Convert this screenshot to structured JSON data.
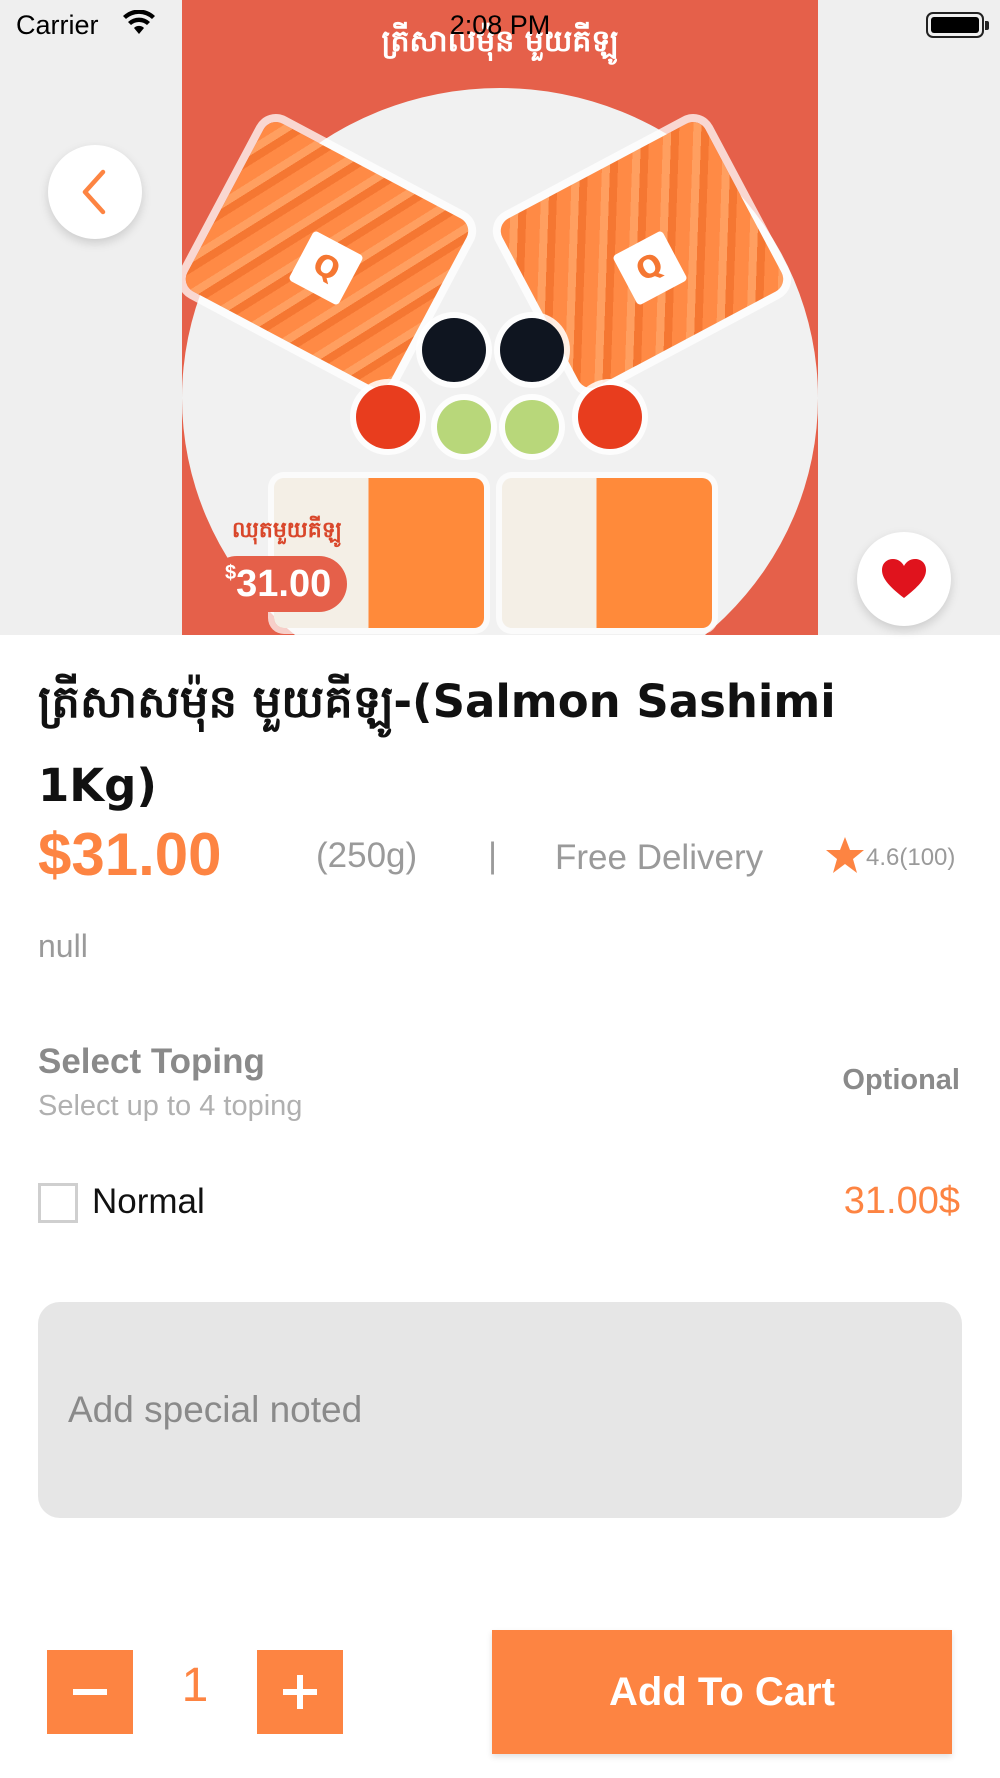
{
  "status_bar": {
    "carrier": "Carrier",
    "time": "2:08 PM",
    "wifi_icon": "wifi-icon",
    "battery_icon": "battery-icon"
  },
  "hero": {
    "banner_text": "ត្រីសាលម៉ុន មួយគីឡូ",
    "promo_caption": "ឈុតមួយគីឡូ",
    "promo_currency": "$",
    "promo_price": "31.00",
    "back_icon": "chevron-left-icon",
    "favorite_icon": "heart-icon"
  },
  "product": {
    "title": "ត្រីសាសម៉ុន មួយគីឡូ-(Salmon Sashimi 1Kg)",
    "price": "$31.00",
    "weight": "(250g)",
    "separator": "|",
    "delivery": "Free Delivery",
    "rating": "4.6(100)",
    "description": "null"
  },
  "topping": {
    "title": "Select Toping",
    "subtitle": "Select up to 4 toping",
    "requirement": "Optional",
    "options": [
      {
        "label": "Normal",
        "price": "31.00$",
        "checked": false
      }
    ]
  },
  "note": {
    "placeholder": "Add special noted",
    "value": ""
  },
  "cart": {
    "quantity": "1",
    "add_label": "Add To Cart"
  },
  "colors": {
    "accent": "#fd8442",
    "heart": "#e0131d",
    "hero_background": "#e5604a",
    "note_background": "#e6e6e6"
  }
}
